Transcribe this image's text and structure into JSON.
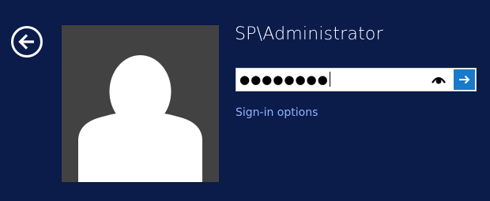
{
  "user": {
    "username": "SP\\Administrator"
  },
  "password": {
    "masked_value": "●●●●●●●●"
  },
  "links": {
    "sign_in_options": "Sign-in options"
  },
  "icons": {
    "back": "back-arrow-icon",
    "avatar": "user-avatar-icon",
    "reveal": "eye-icon",
    "submit": "arrow-right-icon"
  },
  "colors": {
    "background": "#0b1b4a",
    "tile": "#424242",
    "accent": "#1979ca",
    "link": "#8fb4ff"
  }
}
